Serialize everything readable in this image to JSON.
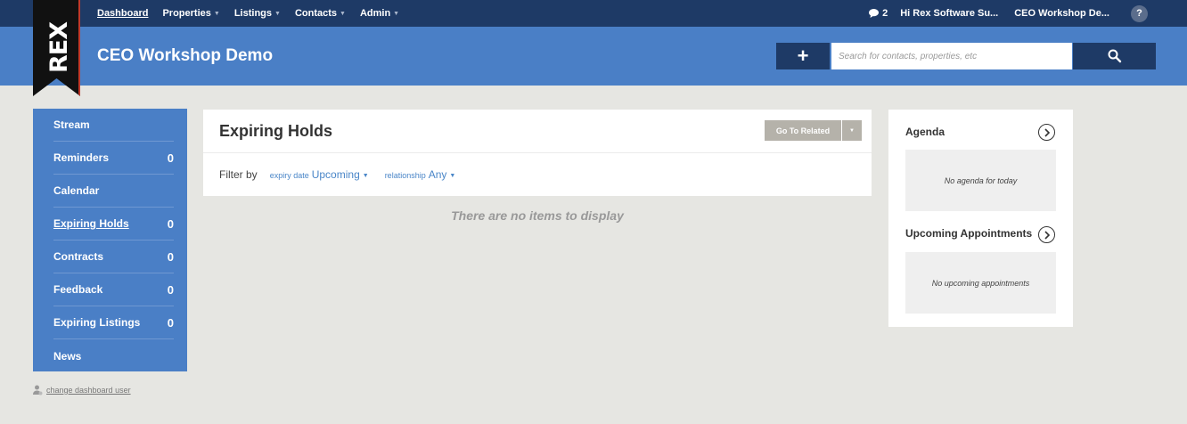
{
  "nav": {
    "items": [
      {
        "label": "Dashboard",
        "caret": ""
      },
      {
        "label": "Properties",
        "caret": "▼"
      },
      {
        "label": "Listings",
        "caret": "▼"
      },
      {
        "label": "Contacts",
        "caret": "▼"
      },
      {
        "label": "Admin",
        "caret": "▼"
      }
    ],
    "messages_count": "2",
    "greeting": "Hi Rex Software Su...",
    "account": "CEO Workshop De...",
    "help": "?"
  },
  "header": {
    "logo_text": "REX",
    "title": "CEO Workshop Demo",
    "add_label": "+",
    "search_placeholder": "Search for contacts, properties, etc"
  },
  "sidebar": {
    "items": [
      {
        "label": "Stream",
        "count": ""
      },
      {
        "label": "Reminders",
        "count": "0"
      },
      {
        "label": "Calendar",
        "count": ""
      },
      {
        "label": "Expiring Holds",
        "count": "0"
      },
      {
        "label": "Contracts",
        "count": "0"
      },
      {
        "label": "Feedback",
        "count": "0"
      },
      {
        "label": "Expiring Listings",
        "count": "0"
      },
      {
        "label": "News",
        "count": ""
      }
    ],
    "change_user": "change dashboard user"
  },
  "main": {
    "title": "Expiring Holds",
    "goto_label": "Go To Related",
    "filter_by": "Filter by",
    "filters": [
      {
        "key": "expiry date",
        "value": "Upcoming"
      },
      {
        "key": "relationship",
        "value": "Any"
      }
    ],
    "empty": "There are no items to display"
  },
  "right": {
    "agenda_title": "Agenda",
    "agenda_empty": "No agenda for today",
    "upcoming_title": "Upcoming Appointments",
    "upcoming_empty": "No upcoming appointments"
  },
  "colors": {
    "nav_bg": "#1e3a66",
    "header_bg": "#4a7fc6",
    "page_bg": "#e6e6e2",
    "link": "#4a86c8"
  }
}
